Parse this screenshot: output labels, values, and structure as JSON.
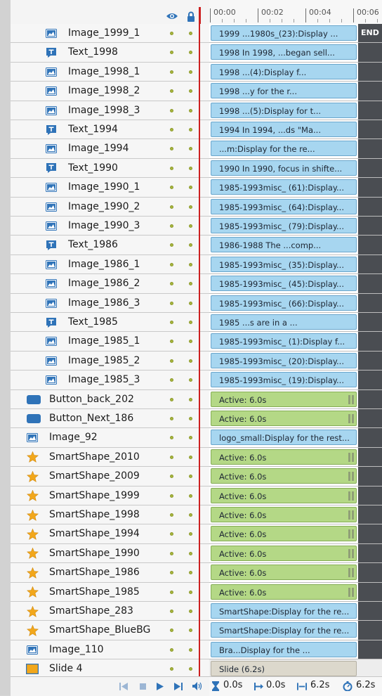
{
  "ruler": {
    "labels": [
      "00:00",
      "00:02",
      "00:04",
      "00:06"
    ]
  },
  "timeline": {
    "end_label": "END",
    "rows": [
      {
        "icon": "image",
        "label": "Image_1999_1",
        "bar": "1999 ...1980s_(23):Display ...",
        "bar_type": "blue"
      },
      {
        "icon": "text",
        "label": "Text_1998",
        "bar": "1998 In 1998, ...began sell...",
        "bar_type": "blue"
      },
      {
        "icon": "image",
        "label": "Image_1998_1",
        "bar": "1998 ...(4):Display f...",
        "bar_type": "blue"
      },
      {
        "icon": "image",
        "label": "Image_1998_2",
        "bar": "1998 ...y for the r...",
        "bar_type": "blue"
      },
      {
        "icon": "image",
        "label": "Image_1998_3",
        "bar": "1998 ...(5):Display for t...",
        "bar_type": "blue"
      },
      {
        "icon": "text",
        "label": "Text_1994",
        "bar": "1994 In 1994, ...ds \"Ma...",
        "bar_type": "blue"
      },
      {
        "icon": "image",
        "label": "Image_1994",
        "bar": "...m:Display for the re...",
        "bar_type": "blue"
      },
      {
        "icon": "text",
        "label": "Text_1990",
        "bar": "1990 In 1990, focus in shifte...",
        "bar_type": "blue"
      },
      {
        "icon": "image",
        "label": "Image_1990_1",
        "bar": "1985-1993misc_ (61):Display...",
        "bar_type": "blue"
      },
      {
        "icon": "image",
        "label": "Image_1990_2",
        "bar": "1985-1993misc_ (64):Display...",
        "bar_type": "blue"
      },
      {
        "icon": "image",
        "label": "Image_1990_3",
        "bar": "1985-1993misc_ (79):Display...",
        "bar_type": "blue"
      },
      {
        "icon": "text",
        "label": "Text_1986",
        "bar": "1986-1988 The ...comp...",
        "bar_type": "blue"
      },
      {
        "icon": "image",
        "label": "Image_1986_1",
        "bar": "1985-1993misc_ (35):Display...",
        "bar_type": "blue"
      },
      {
        "icon": "image",
        "label": "Image_1986_2",
        "bar": "1985-1993misc_ (45):Display...",
        "bar_type": "blue"
      },
      {
        "icon": "image",
        "label": "Image_1986_3",
        "bar": "1985-1993misc_ (66):Display...",
        "bar_type": "blue"
      },
      {
        "icon": "text",
        "label": "Text_1985",
        "bar": "1985 ...s are in a ...",
        "bar_type": "blue"
      },
      {
        "icon": "image",
        "label": "Image_1985_1",
        "bar": "1985-1993misc_ (1):Display f...",
        "bar_type": "blue"
      },
      {
        "icon": "image",
        "label": "Image_1985_2",
        "bar": "1985-1993misc_ (20):Display...",
        "bar_type": "blue"
      },
      {
        "icon": "image",
        "label": "Image_1985_3",
        "bar": "1985-1993misc_ (19):Display...",
        "bar_type": "blue"
      },
      {
        "icon": "button",
        "label": "Button_back_202",
        "bar": "Active: 6.0s",
        "bar_type": "green"
      },
      {
        "icon": "button",
        "label": "Button_Next_186",
        "bar": "Active: 6.0s",
        "bar_type": "green"
      },
      {
        "icon": "image",
        "label": "Image_92",
        "bar": "logo_small:Display for the rest...",
        "bar_type": "blue"
      },
      {
        "icon": "star",
        "label": "SmartShape_2010",
        "bar": "Active: 6.0s",
        "bar_type": "green"
      },
      {
        "icon": "star",
        "label": "SmartShape_2009",
        "bar": "Active: 6.0s",
        "bar_type": "green"
      },
      {
        "icon": "star",
        "label": "SmartShape_1999",
        "bar": "Active: 6.0s",
        "bar_type": "green"
      },
      {
        "icon": "star",
        "label": "SmartShape_1998",
        "bar": "Active: 6.0s",
        "bar_type": "green"
      },
      {
        "icon": "star",
        "label": "SmartShape_1994",
        "bar": "Active: 6.0s",
        "bar_type": "green"
      },
      {
        "icon": "star",
        "label": "SmartShape_1990",
        "bar": "Active: 6.0s",
        "bar_type": "green"
      },
      {
        "icon": "star",
        "label": "SmartShape_1986",
        "bar": "Active: 6.0s",
        "bar_type": "green"
      },
      {
        "icon": "star",
        "label": "SmartShape_1985",
        "bar": "Active: 6.0s",
        "bar_type": "green"
      },
      {
        "icon": "star",
        "label": "SmartShape_283",
        "bar": "SmartShape:Display for the re...",
        "bar_type": "blue"
      },
      {
        "icon": "star",
        "label": "SmartShape_BlueBG",
        "bar": "SmartShape:Display for the re...",
        "bar_type": "blue"
      },
      {
        "icon": "image",
        "label": "Image_110",
        "bar": "Bra...Display for the ...",
        "bar_type": "blue"
      },
      {
        "icon": "slide",
        "label": "Slide 4",
        "bar": "Slide (6.2s)",
        "bar_type": "slide"
      }
    ]
  },
  "footer": {
    "current_time": "0.0s",
    "start_time": "0.0s",
    "duration": "6.2s",
    "slide_duration": "6.2s"
  },
  "colors": {
    "accent_blue": "#2f73b8",
    "playhead": "#cc2020",
    "bar_blue": "#a7d6f0",
    "bar_green": "#b4d886",
    "star": "#f2a71b"
  }
}
